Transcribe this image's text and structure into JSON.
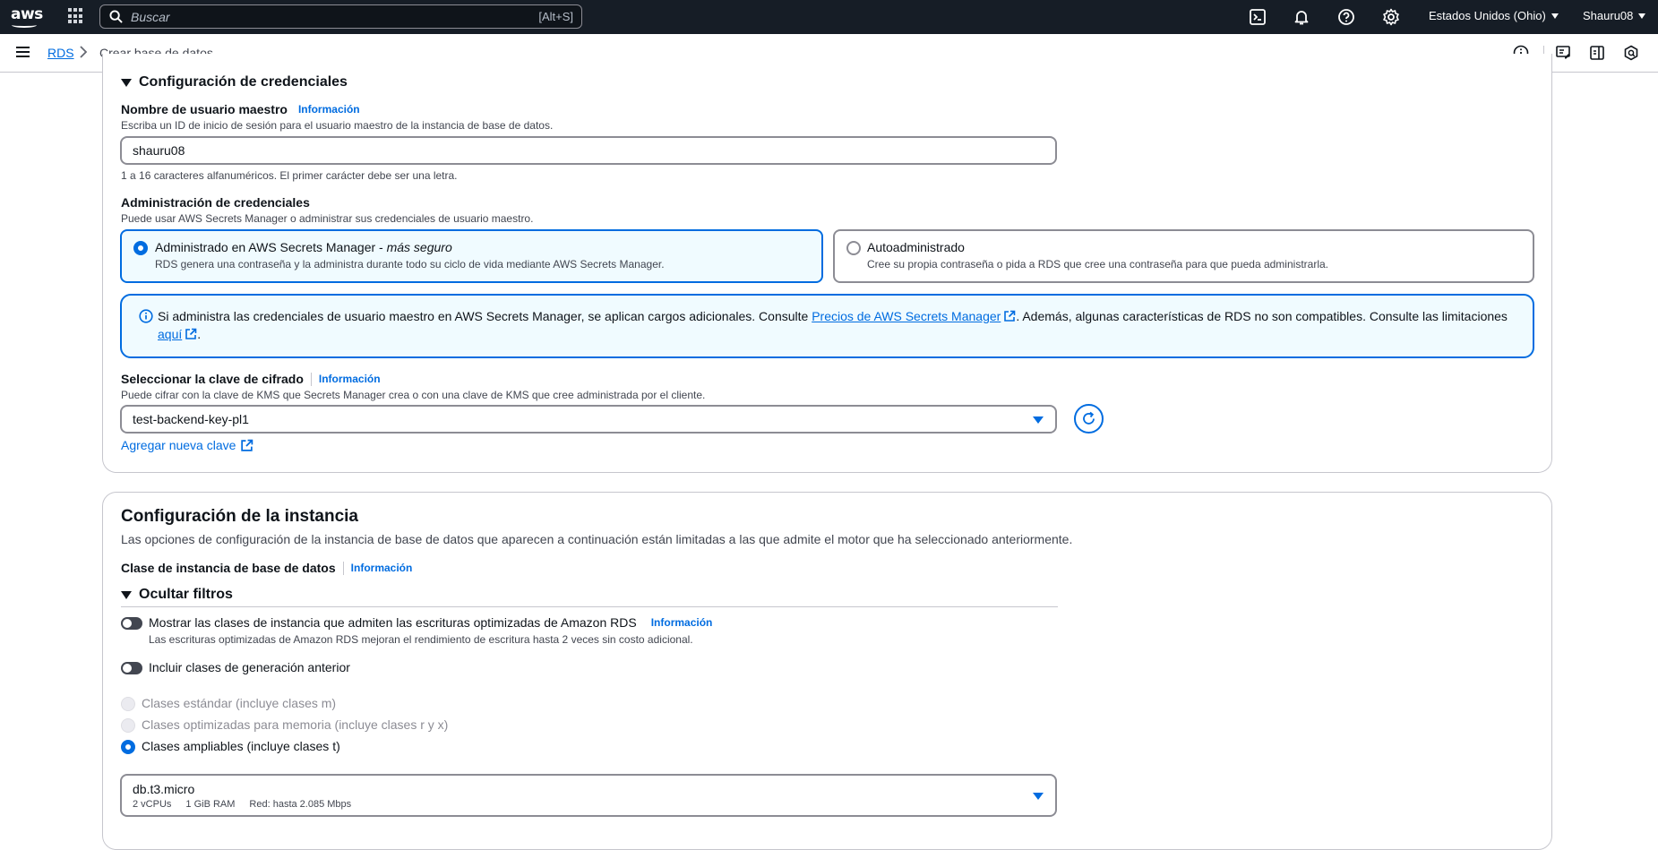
{
  "topnav": {
    "logo": "aws",
    "search_placeholder": "Buscar",
    "search_shortcut": "[Alt+S]",
    "region": "Estados Unidos (Ohio)",
    "user": "Shauru08",
    "icons": [
      "cloudshell-icon",
      "bell-icon",
      "help-icon",
      "gear-icon"
    ]
  },
  "breadcrumb": {
    "root": "RDS",
    "current": "Crear base de datos"
  },
  "credentials": {
    "section_title": "Configuración de credenciales",
    "username_label": "Nombre de usuario maestro",
    "username_info": "Información",
    "username_desc": "Escriba un ID de inicio de sesión para el usuario maestro de la instancia de base de datos.",
    "username_value": "shauru08",
    "username_hint": "1 a 16 caracteres alfanuméricos. El primer carácter debe ser una letra.",
    "mgmt_label": "Administración de credenciales",
    "mgmt_desc": "Puede usar AWS Secrets Manager o administrar sus credenciales de usuario maestro.",
    "option_managed_title": "Administrado en AWS Secrets Manager - ",
    "option_managed_emph": "más seguro",
    "option_managed_desc": "RDS genera una contraseña y la administra durante todo su ciclo de vida mediante AWS Secrets Manager.",
    "option_self_title": "Autoadministrado",
    "option_self_desc": "Cree su propia contraseña o pida a RDS que cree una contraseña para que pueda administrarla.",
    "alert_text_1": "Si administra las credenciales de usuario maestro en AWS Secrets Manager, se aplican cargos adicionales. Consulte ",
    "alert_link_1": "Precios de AWS Secrets Manager",
    "alert_text_2": ". Además, algunas características de RDS no son compatibles. Consulte las limitaciones ",
    "alert_link_2": "aquí",
    "alert_text_3": ".",
    "key_label": "Seleccionar la clave de cifrado",
    "key_info": "Información",
    "key_desc": "Puede cifrar con la clave de KMS que Secrets Manager crea o con una clave de KMS que cree administrada por el cliente.",
    "key_value": "test-backend-key-pl1",
    "add_key_link": "Agregar nueva clave"
  },
  "instance": {
    "title": "Configuración de la instancia",
    "desc": "Las opciones de configuración de la instancia de base de datos que aparecen a continuación están limitadas a las que admite el motor que ha seleccionado anteriormente.",
    "class_label": "Clase de instancia de base de datos",
    "class_info": "Información",
    "filters_title": "Ocultar filtros",
    "toggle_optimized_label": "Mostrar las clases de instancia que admiten las escrituras optimizadas de Amazon RDS",
    "toggle_optimized_info": "Información",
    "toggle_optimized_desc": "Las escrituras optimizadas de Amazon RDS mejoran el rendimiento de escritura hasta 2 veces sin costo adicional.",
    "toggle_prev_label": "Incluir clases de generación anterior",
    "radio_standard": "Clases estándar (incluye clases m)",
    "radio_memory": "Clases optimizadas para memoria (incluye clases r y x)",
    "radio_burstable": "Clases ampliables (incluye clases t)",
    "selected_class": "db.t3.micro",
    "class_vcpu": "2 vCPUs",
    "class_ram": "1 GiB RAM",
    "class_network": "Red: hasta 2.085 Mbps"
  },
  "colors": {
    "accent": "#006ce0",
    "nav_bg": "#161d26"
  }
}
